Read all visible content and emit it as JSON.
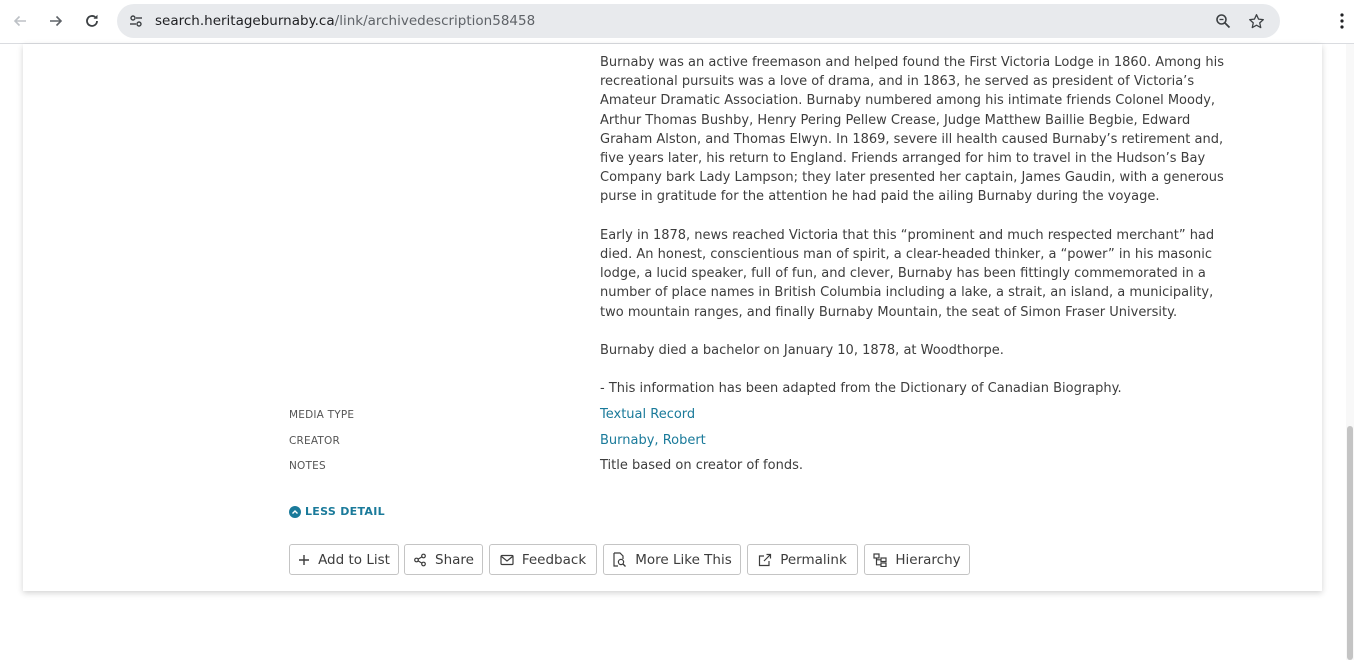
{
  "browser": {
    "url_host": "search.heritageburnaby.ca",
    "url_path": "/link/archivedescription58458"
  },
  "description": {
    "paragraphs": [
      "Burnaby was an active freemason and helped found the First Victoria Lodge in 1860. Among his recreational pursuits was a love of drama, and in 1863, he served as president of Victoria’s Amateur Dramatic Association. Burnaby numbered among his intimate friends Colonel Moody, Arthur Thomas Bushby, Henry Pering Pellew Crease, Judge Matthew Baillie Begbie, Edward Graham Alston, and Thomas Elwyn. In 1869, severe ill health caused Burnaby’s retirement and, five years later, his return to England. Friends arranged for him to travel in the Hudson’s Bay Company bark Lady Lampson; they later presented her captain, James Gaudin, with a generous purse in gratitude for the attention he had paid the ailing Burnaby during the voyage.",
      "Early in 1878, news reached Victoria that this “prominent and much respected merchant” had died. An honest, conscientious man of spirit, a clear-headed thinker, a “power” in his masonic lodge, a lucid speaker, full of fun, and clever, Burnaby has been fittingly commemorated in a number of place names in British Columbia including a lake, a strait, an island, a municipality, two mountain ranges, and finally Burnaby Mountain, the seat of Simon Fraser University.",
      "Burnaby died a bachelor on January 10, 1878, at Woodthorpe.",
      "- This information has been adapted from the Dictionary of Canadian Biography."
    ]
  },
  "metadata": {
    "media_type_label": "MEDIA TYPE",
    "media_type_value": "Textual Record",
    "creator_label": "CREATOR",
    "creator_value": "Burnaby, Robert",
    "notes_label": "NOTES",
    "notes_value": "Title based on creator of fonds."
  },
  "less_detail_label": "LESS DETAIL",
  "actions": {
    "add_to_list": "Add to List",
    "share": "Share",
    "feedback": "Feedback",
    "more_like_this": "More Like This",
    "permalink": "Permalink",
    "hierarchy": "Hierarchy"
  },
  "colors": {
    "link": "#1a7a9a",
    "text": "#3d3d3d"
  }
}
